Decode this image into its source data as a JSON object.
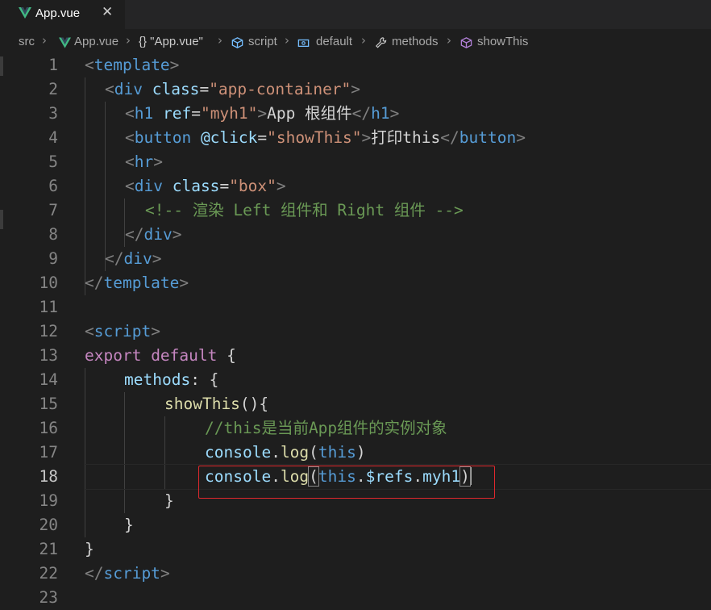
{
  "tab": {
    "label": "App.vue",
    "close": "✕"
  },
  "breadcrumb": {
    "items": [
      "src",
      "App.vue",
      "{} \"App.vue\"",
      "script",
      "default",
      "methods",
      "showThis"
    ],
    "separator": "›"
  },
  "lines": [
    {
      "num": "1"
    },
    {
      "num": "2"
    },
    {
      "num": "3"
    },
    {
      "num": "4"
    },
    {
      "num": "5"
    },
    {
      "num": "6"
    },
    {
      "num": "7"
    },
    {
      "num": "8"
    },
    {
      "num": "9"
    },
    {
      "num": "10"
    },
    {
      "num": "11"
    },
    {
      "num": "12"
    },
    {
      "num": "13"
    },
    {
      "num": "14"
    },
    {
      "num": "15"
    },
    {
      "num": "16"
    },
    {
      "num": "17"
    },
    {
      "num": "18"
    },
    {
      "num": "19"
    },
    {
      "num": "20"
    },
    {
      "num": "21"
    },
    {
      "num": "22"
    },
    {
      "num": "23"
    }
  ],
  "code": {
    "l1": {
      "a": "<",
      "b": "template",
      "c": ">"
    },
    "l2": {
      "a": "<",
      "b": "div",
      "c": " class",
      "d": "=",
      "e": "\"app-container\"",
      "f": ">"
    },
    "l3": {
      "a": "<",
      "b": "h1",
      "c": " ref",
      "d": "=",
      "e": "\"myh1\"",
      "f": ">",
      "g": "App 根组件",
      "h": "</",
      "i": "h1",
      "j": ">"
    },
    "l4": {
      "a": "<",
      "b": "button",
      "c": " @click",
      "d": "=",
      "e": "\"showThis\"",
      "f": ">",
      "g": "打印this",
      "h": "</",
      "i": "button",
      "j": ">"
    },
    "l5": {
      "a": "<",
      "b": "hr",
      "c": ">"
    },
    "l6": {
      "a": "<",
      "b": "div",
      "c": " class",
      "d": "=",
      "e": "\"box\"",
      "f": ">"
    },
    "l7": {
      "a": "<!-- 渲染 Left 组件和 Right 组件 -->"
    },
    "l8": {
      "a": "</",
      "b": "div",
      "c": ">"
    },
    "l9": {
      "a": "</",
      "b": "div",
      "c": ">"
    },
    "l10": {
      "a": "</",
      "b": "template",
      "c": ">"
    },
    "l12": {
      "a": "<",
      "b": "script",
      "c": ">"
    },
    "l13": {
      "a": "export",
      "b": " default",
      "c": " {"
    },
    "l14": {
      "a": "methods",
      "b": ": {"
    },
    "l15": {
      "a": "showThis",
      "b": "(){"
    },
    "l16": {
      "a": "//this是当前App组件的实例对象"
    },
    "l17": {
      "a": "console",
      "b": ".",
      "c": "log",
      "d": "(",
      "e": "this",
      "f": ")"
    },
    "l18": {
      "a": "console",
      "b": ".",
      "c": "log",
      "d": "(",
      "e": "this",
      "f": ".",
      "g": "$refs",
      "h": ".",
      "i": "myh1",
      "j": ")"
    },
    "l19": {
      "a": "}"
    },
    "l20": {
      "a": "}"
    },
    "l21": {
      "a": "}"
    },
    "l22": {
      "a": "</",
      "b": "script",
      "c": ">"
    }
  },
  "colors": {
    "highlight_box": "#e0282d",
    "background": "#1e1e1e"
  },
  "icons": [
    "vue-icon",
    "close-icon",
    "chevron-right-icon",
    "braces-icon",
    "cube-icon",
    "field-icon",
    "wrench-icon"
  ]
}
